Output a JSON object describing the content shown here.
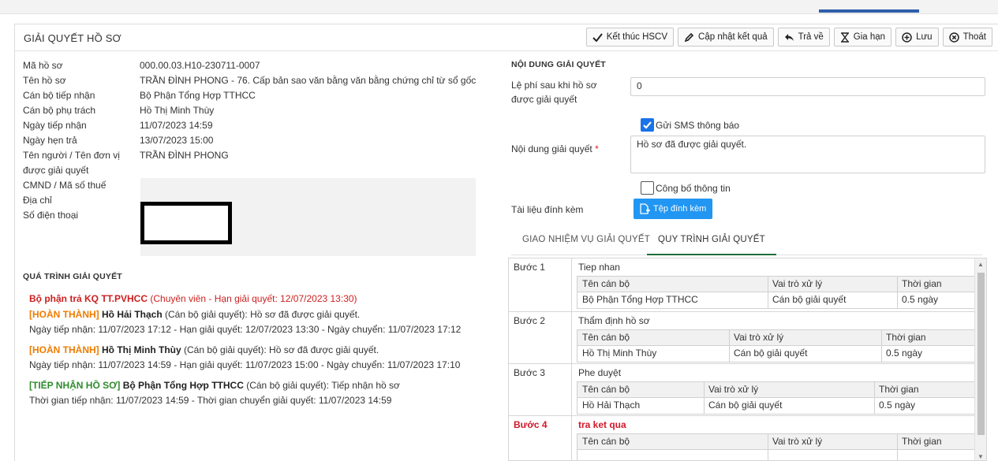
{
  "header": {
    "title": "GIẢI QUYẾT HỒ SƠ",
    "buttons": [
      {
        "label": "Kết thúc HSCV",
        "icon": "check-icon"
      },
      {
        "label": "Cập nhật kết quả",
        "icon": "pencil-icon"
      },
      {
        "label": "Trả về",
        "icon": "reply-icon"
      },
      {
        "label": "Gia hạn",
        "icon": "hourglass-icon"
      },
      {
        "label": "Lưu",
        "icon": "plus-circle-icon"
      },
      {
        "label": "Thoát",
        "icon": "close-circle-icon"
      }
    ]
  },
  "info": [
    {
      "label": "Mã hồ sơ",
      "value": "000.00.03.H10-230711-0007"
    },
    {
      "label": "Tên hồ sơ",
      "value": "TRẦN ĐÌNH PHONG - 76. Cấp bản sao văn bằng văn bằng chứng chỉ từ sổ gốc"
    },
    {
      "label": "Cán bộ tiếp nhận",
      "value": "Bộ Phận Tổng Hợp TTHCC"
    },
    {
      "label": "Cán bộ phụ trách",
      "value": "Hồ Thị Minh Thùy"
    },
    {
      "label": "Ngày tiếp nhận",
      "value": "11/07/2023 14:59"
    },
    {
      "label": "Ngày hẹn trả",
      "value": "13/07/2023 15:00"
    },
    {
      "label": "Tên người / Tên đơn vị",
      "value": "TRẦN ĐÌNH PHONG"
    },
    {
      "label": "được giải quyết",
      "value": ""
    },
    {
      "label": "CMND / Mã số thuế",
      "value": ""
    },
    {
      "label": "Địa chỉ",
      "value": ""
    },
    {
      "label": "Số điện thoại",
      "value": ""
    }
  ],
  "process": {
    "title": "QUÁ TRÌNH GIẢI QUYẾT",
    "current": "Bộ phận trả KQ TT.PVHCC",
    "current_note": "(Chuyên viên - Hạn giải quyết: 12/07/2023 13:30)",
    "items": [
      {
        "status": "[HOÀN THÀNH]",
        "person": "Hồ Hải Thạch",
        "text": " (Cán bộ giải quyết): Hồ sơ đã được giải quyết.",
        "detail": "Ngày tiếp nhận: 11/07/2023 17:12 - Hạn giải quyết: 12/07/2023 13:30 - Ngày chuyển: 11/07/2023 17:12"
      },
      {
        "status": "[HOÀN THÀNH]",
        "person": "Hồ Thị Minh Thùy",
        "text": " (Cán bộ giải quyết): Hồ sơ đã được giải quyết.",
        "detail": "Ngày tiếp nhận: 11/07/2023 14:59 - Hạn giải quyết: 11/07/2023 15:00 - Ngày chuyển: 11/07/2023 17:10"
      },
      {
        "status": "[TIẾP NHẬN HỒ SƠ]",
        "person": "Bộ Phận Tổng Hợp TTHCC",
        "text": " (Cán bộ giải quyết): Tiếp nhận hồ sơ",
        "detail": "Thời gian tiếp nhận: 11/07/2023 14:59 - Thời gian chuyển giải quyết: 11/07/2023 14:59"
      }
    ]
  },
  "form": {
    "title": "NỘI DUNG GIẢI QUYẾT",
    "fee_label_1": "Lệ phí sau khi hồ sơ",
    "fee_label_2": "được giải quyết",
    "fee_value": "0",
    "sms_label": "Gửi SMS thông báo",
    "sms_checked": true,
    "content_label": "Nội dung giải quyết",
    "required_mark": "*",
    "content_value": "Hồ sơ đã được giải quyết.",
    "publish_label": "Công bố thông tin",
    "publish_checked": false,
    "attach_label": "Tài liệu đính kèm",
    "attach_button": "Tệp đính kèm"
  },
  "tabs": [
    {
      "label": "GIAO NHIỆM VỤ GIẢI QUYẾT",
      "active": false
    },
    {
      "label": "QUY TRÌNH GIẢI QUYẾT",
      "active": true
    }
  ],
  "steps": {
    "headers": {
      "name": "Tên cán bộ",
      "role": "Vai trò xử lý",
      "time": "Thời gian"
    },
    "items": [
      {
        "label": "Bước 1",
        "name": "Tiep nhan",
        "officer": "Bộ Phận Tổng Hợp TTHCC",
        "role": "Cán bộ giải quyết",
        "time": "0.5 ngày"
      },
      {
        "label": "Bước 2",
        "name": "Thẩm định hồ sơ",
        "officer": "Hồ Thị Minh Thùy",
        "role": "Cán bộ giải quyết",
        "time": "0.5 ngày"
      },
      {
        "label": "Bước 3",
        "name": "Phe duyệt",
        "officer": "Hồ Hải Thạch",
        "role": "Cán bộ giải quyết",
        "time": "0.5 ngày"
      },
      {
        "label": "Bước 4",
        "name": "tra ket qua",
        "officer": "",
        "role": "",
        "time": ""
      }
    ]
  }
}
